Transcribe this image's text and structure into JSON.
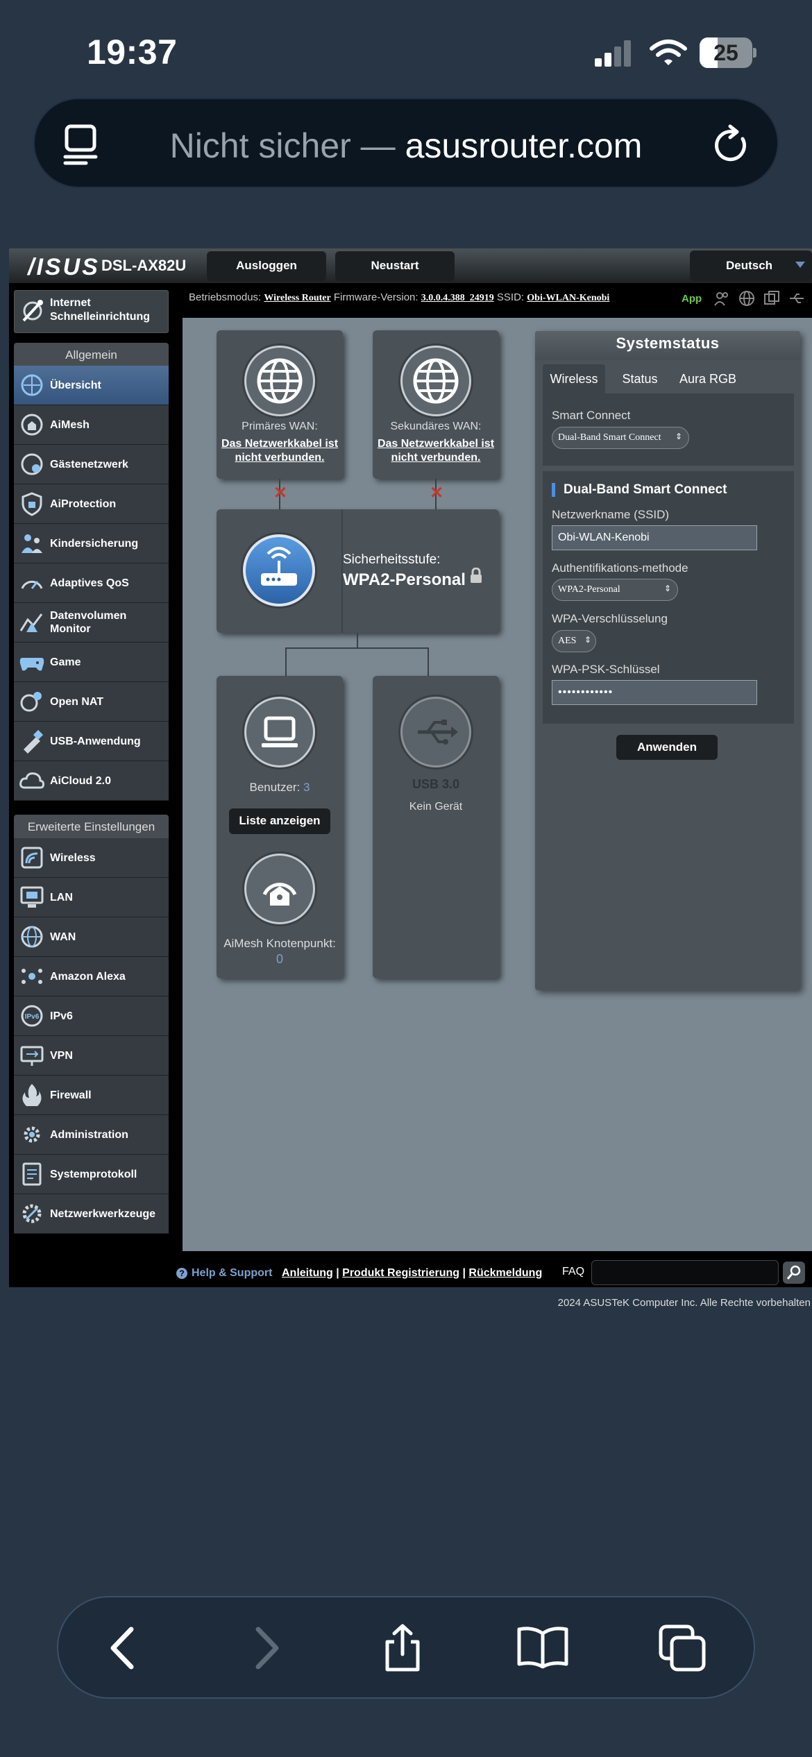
{
  "status_bar": {
    "time": "19:37",
    "battery": "25"
  },
  "browser": {
    "url_prefix": "Nicht sicher — ",
    "url_domain": "asusrouter.com"
  },
  "header": {
    "logo": "/ISUS",
    "model": "DSL-AX82U",
    "logout": "Ausloggen",
    "reboot": "Neustart",
    "language": "Deutsch"
  },
  "infobar": {
    "mode_label": "Betriebsmodus:",
    "mode_value": "Wireless Router",
    "fw_label": "Firmware-Version:",
    "fw_value": "3.0.0.4.388_24919",
    "ssid_label": "SSID:",
    "ssid_value": "Obi-WLAN-Kenobi",
    "app": "App"
  },
  "sidebar": {
    "qis": "Internet Schnelleinrichtung",
    "general_title": "Allgemein",
    "general": [
      {
        "label": "Übersicht",
        "icon": "overview-icon"
      },
      {
        "label": "AiMesh",
        "icon": "aimesh-icon"
      },
      {
        "label": "Gästenetzwerk",
        "icon": "guest-network-icon"
      },
      {
        "label": "AiProtection",
        "icon": "shield-icon"
      },
      {
        "label": "Kindersicherung",
        "icon": "parental-control-icon"
      },
      {
        "label": "Adaptives QoS",
        "icon": "qos-icon"
      },
      {
        "label": "Datenvolumen Monitor",
        "icon": "traffic-monitor-icon"
      },
      {
        "label": "Game",
        "icon": "gamepad-icon"
      },
      {
        "label": "Open NAT",
        "icon": "open-nat-icon"
      },
      {
        "label": "USB-Anwendung",
        "icon": "usb-app-icon"
      },
      {
        "label": "AiCloud 2.0",
        "icon": "cloud-icon"
      }
    ],
    "advanced_title": "Erweiterte Einstellungen",
    "advanced": [
      {
        "label": "Wireless",
        "icon": "wireless-icon"
      },
      {
        "label": "LAN",
        "icon": "lan-icon"
      },
      {
        "label": "WAN",
        "icon": "wan-globe-icon"
      },
      {
        "label": "Amazon Alexa",
        "icon": "alexa-icon"
      },
      {
        "label": "IPv6",
        "icon": "ipv6-icon"
      },
      {
        "label": "VPN",
        "icon": "vpn-icon"
      },
      {
        "label": "Firewall",
        "icon": "firewall-icon"
      },
      {
        "label": "Administration",
        "icon": "admin-gear-icon"
      },
      {
        "label": "Systemprotokoll",
        "icon": "syslog-icon"
      },
      {
        "label": "Netzwerkwerkzeuge",
        "icon": "network-tools-icon"
      }
    ]
  },
  "map": {
    "wan1_label": "Primäres WAN:",
    "wan1_status": "Das Netzwerkkabel ist nicht verbunden.",
    "wan2_label": "Sekundäres WAN:",
    "wan2_status": "Das Netzwerkkabel ist nicht verbunden.",
    "security_label": "Sicherheitsstufe:",
    "security_value": "WPA2-Personal",
    "clients_label": "Benutzer:",
    "clients_count": "3",
    "clients_button": "Liste anzeigen",
    "usb_label": "USB 3.0",
    "usb_status": "Kein Gerät",
    "aimesh_label": "AiMesh Knotenpunkt:",
    "aimesh_count": "0"
  },
  "system_status": {
    "title": "Systemstatus",
    "tabs": [
      "Wireless",
      "Status",
      "Aura RGB"
    ],
    "smart_connect_label": "Smart Connect",
    "smart_connect_value": "Dual-Band Smart Connect",
    "band_title": "Dual-Band Smart Connect",
    "ssid_label": "Netzwerkname (SSID)",
    "ssid_value": "Obi-WLAN-Kenobi",
    "auth_label": "Authentifikations-methode",
    "auth_value": "WPA2-Personal",
    "enc_label": "WPA-Verschlüsselung",
    "enc_value": "AES",
    "psk_label": "WPA-PSK-Schlüssel",
    "psk_value": "••••••••••••",
    "apply": "Anwenden"
  },
  "footer": {
    "help": "Help & Support",
    "links": [
      "Anleitung",
      "Produkt Registrierung",
      "Rückmeldung"
    ],
    "faq": "FAQ",
    "copyright": "2024 ASUSTeK Computer Inc. Alle Rechte vorbehalten"
  },
  "colors": {
    "accent": "#4a90e2",
    "app_green": "#6ec64e",
    "error_red": "#c0392b"
  }
}
